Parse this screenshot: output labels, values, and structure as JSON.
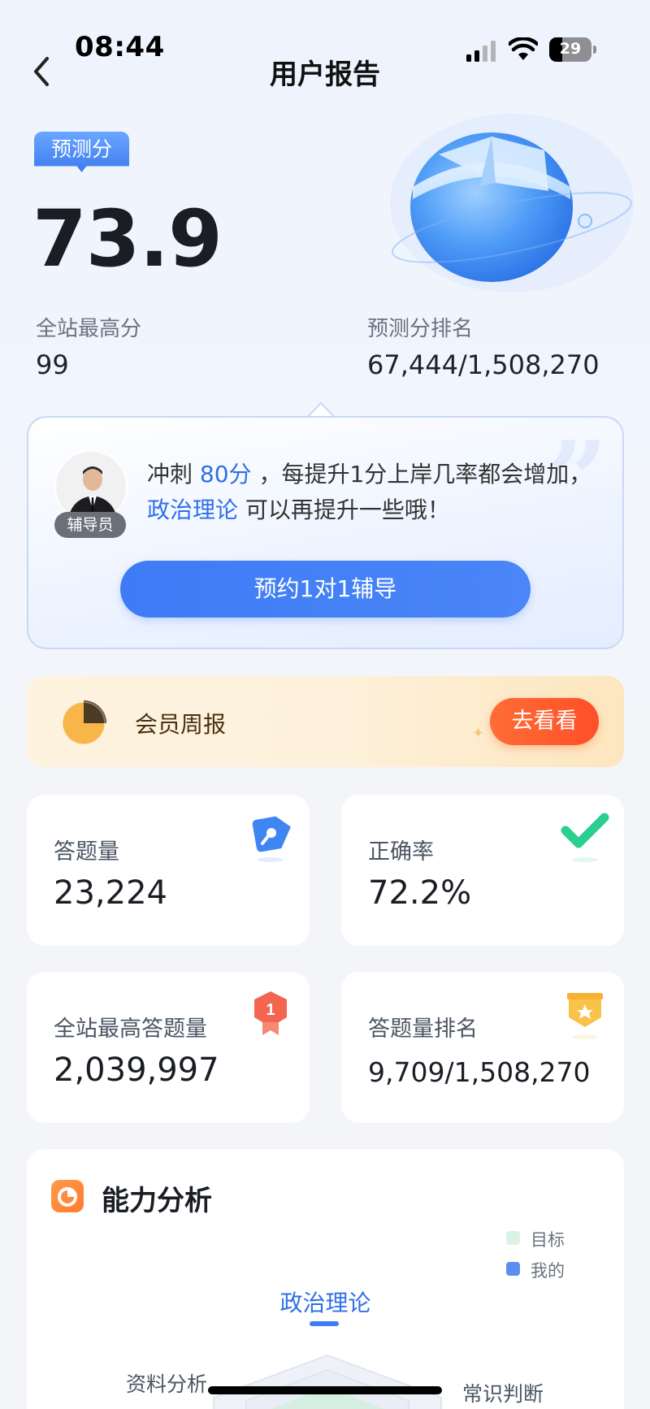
{
  "status_bar": {
    "time": "08:44",
    "battery": "29"
  },
  "nav": {
    "title": "用户报告"
  },
  "score": {
    "tag": "预测分",
    "value": "73.9",
    "site_max_label": "全站最高分",
    "site_max_value": "99",
    "rank_label": "预测分排名",
    "rank_value": "67,444/1,508,270"
  },
  "advisor": {
    "badge": "辅导员",
    "text_1": "冲刺 ",
    "highlight_1": "80分",
    "text_2": " ，每提升1分上岸几率都会增加， ",
    "highlight_2": "政治理论",
    "text_3": " 可以再提升一些哦！",
    "button": "预约1对1辅导"
  },
  "weekly": {
    "label": "会员周报",
    "button": "去看看"
  },
  "stats": [
    {
      "title": "答题量",
      "value": "23,224",
      "icon": "pencil-tag-icon"
    },
    {
      "title": "正确率",
      "value": "72.2%",
      "icon": "checkmark-icon"
    },
    {
      "title": "全站最高答题量",
      "value": "2,039,997",
      "icon": "rank-one-medal-icon"
    },
    {
      "title": "答题量排名",
      "value": "9,709/1,508,270",
      "icon": "star-badge-icon"
    }
  ],
  "ability": {
    "title": "能力分析",
    "legend": [
      {
        "label": "目标",
        "color": "#d9f2e4"
      },
      {
        "label": "我的",
        "color": "#5b8ef0"
      }
    ],
    "axes": [
      "政治理论",
      "资料分析",
      "常识判断"
    ]
  },
  "colors": {
    "accent": "#3e7bf5",
    "orange": "#ff5a2c",
    "highlight": "#2f6fe8"
  }
}
